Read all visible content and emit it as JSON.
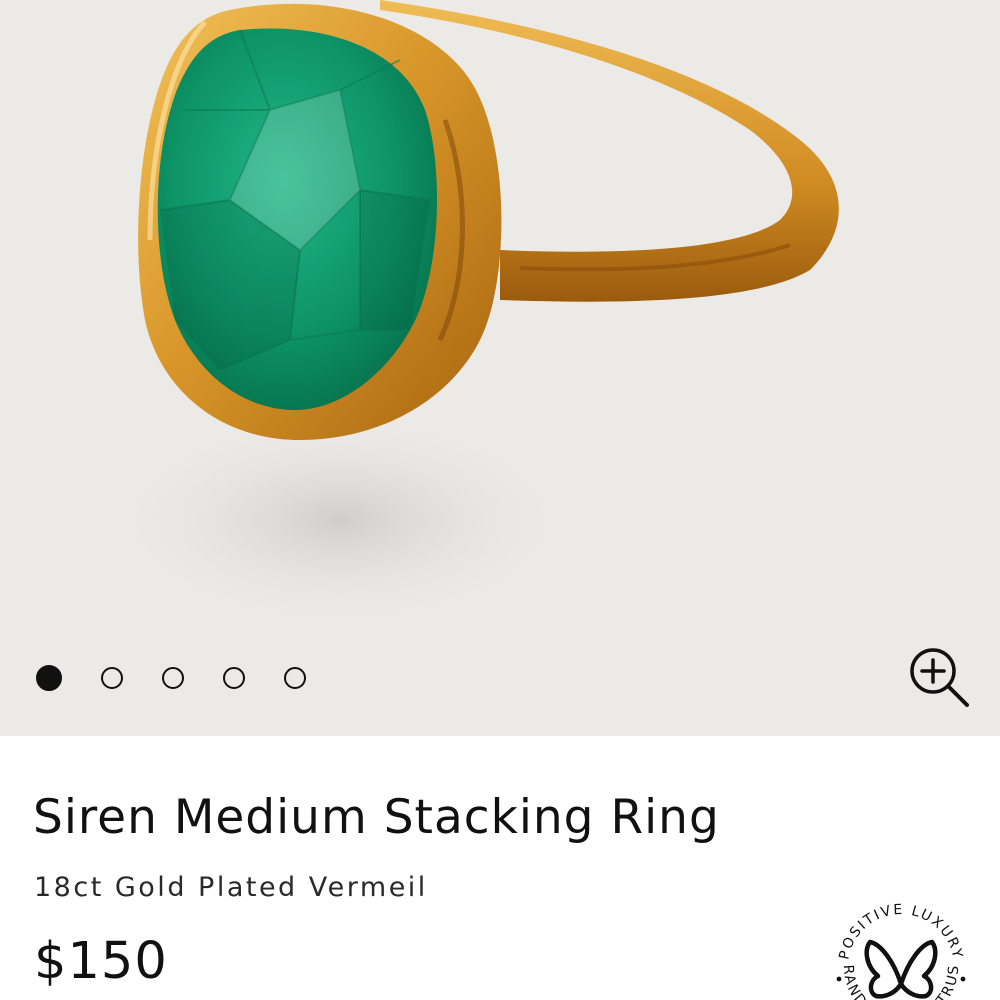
{
  "product": {
    "name": "Siren Medium Stacking Ring",
    "material": "18ct Gold Plated Vermeil",
    "price": "$150"
  },
  "gallery": {
    "image_count": 5,
    "active_index": 0,
    "background_color": "#ebeae7",
    "zoom_icon": "zoom-in-icon"
  },
  "badge": {
    "top_text": "POSITIVE LUXURY",
    "bottom_text": "BRAND YOU CAN TRUST",
    "icon": "butterfly-icon"
  },
  "colors": {
    "gold": "#d9a032",
    "stone": "#0f9a6a",
    "text": "#111111"
  }
}
